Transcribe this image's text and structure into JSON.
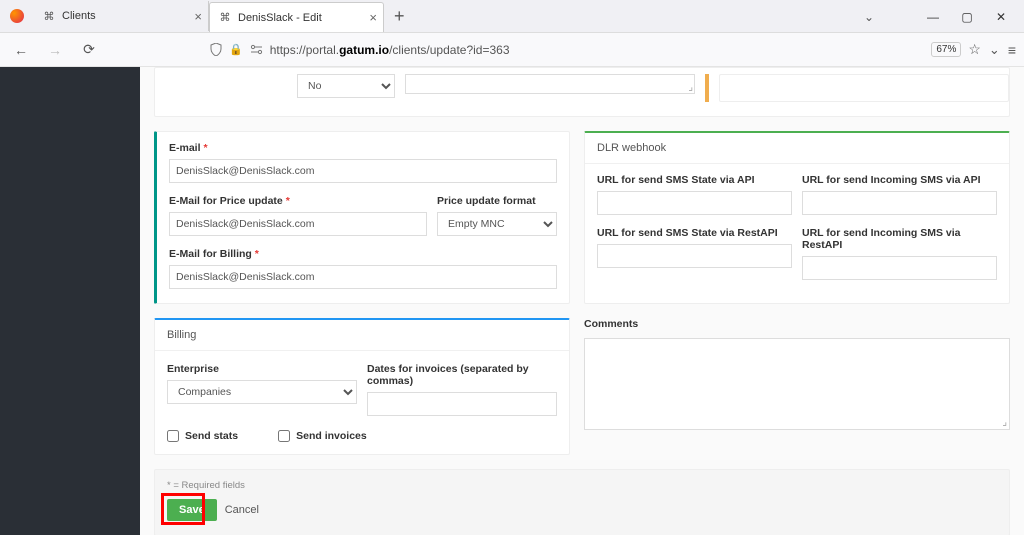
{
  "browser": {
    "tab1": "Clients",
    "tab2": "DenisSlack - Edit",
    "url_host": "gatum.io",
    "url_prefix": "https://portal.",
    "url_path": "/clients/update?id=363",
    "zoom": "67%"
  },
  "topcard": {
    "select_value": "No"
  },
  "emailPanel": {
    "email_label": "E-mail",
    "email_value": "DenisSlack@DenisSlack.com",
    "price_email_label": "E-Mail for Price update",
    "price_email_value": "DenisSlack@DenisSlack.com",
    "price_format_label": "Price update format",
    "price_format_value": "Empty MNC",
    "billing_email_label": "E-Mail for Billing",
    "billing_email_value": "DenisSlack@DenisSlack.com"
  },
  "dlr": {
    "header": "DLR webhook",
    "url_sms_api": "URL for send SMS State via API",
    "url_incoming_api": "URL for send Incoming SMS via API",
    "url_sms_rest": "URL for send SMS State via RestAPI",
    "url_incoming_rest": "URL for send Incoming SMS via RestAPI"
  },
  "billing": {
    "header": "Billing",
    "enterprise_label": "Enterprise",
    "enterprise_value": "Companies",
    "dates_label": "Dates for invoices (separated by commas)",
    "send_stats": "Send stats",
    "send_invoices": "Send invoices"
  },
  "comments": {
    "label": "Comments"
  },
  "footer": {
    "req_note": "* = Required fields",
    "save": "Save",
    "cancel": "Cancel"
  }
}
